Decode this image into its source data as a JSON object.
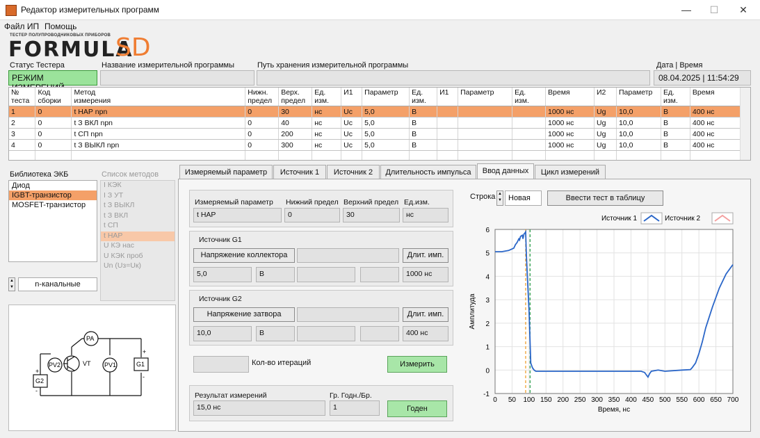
{
  "window": {
    "title": "Редактор измерительных программ",
    "minimize": "—",
    "maximize": "☐",
    "close": "✕"
  },
  "menu": [
    "Файл ИП",
    "Помощь"
  ],
  "logo": {
    "small_text": "ТЕСТЕР ПОЛУПРОВОДНИКОВЫХ ПРИБОРОВ",
    "main": "FORMULA",
    "accent": "SD",
    "accent_color": "#ef7d32"
  },
  "header": {
    "status_label": "Статус Тестера",
    "status_value": "РЕЖИМ ИЗМЕРЕНИЙ",
    "program_name_label": "Название измерительной программы",
    "program_name_value": "",
    "path_label": "Путь хранения измерительной программы",
    "path_value": "",
    "datetime_label": "Дата | Время",
    "datetime_value": "08.04.2025 | 11:54:29"
  },
  "table": {
    "headers": [
      [
        "№",
        "теста"
      ],
      [
        "Код",
        "сборки"
      ],
      [
        "Метод",
        "измерения"
      ],
      [
        "Нижн.",
        "предел"
      ],
      [
        "Верх.",
        "предел"
      ],
      [
        "Ед.",
        "изм."
      ],
      [
        "И1",
        ""
      ],
      [
        "Параметр",
        ""
      ],
      [
        "Ед.",
        "изм."
      ],
      [
        "И1",
        ""
      ],
      [
        "Параметр",
        ""
      ],
      [
        "Ед.",
        "изм."
      ],
      [
        "Время",
        ""
      ],
      [
        "И2",
        ""
      ],
      [
        "Параметр",
        ""
      ],
      [
        "Ед.",
        "изм."
      ],
      [
        "Время",
        ""
      ]
    ],
    "rows": [
      [
        "1",
        "0",
        "t НАР npn",
        "0",
        "30",
        "нс",
        "Uc",
        "5,0",
        "В",
        "",
        "",
        "",
        "1000 нс",
        "Ug",
        "10,0",
        "В",
        "400 нс"
      ],
      [
        "2",
        "0",
        "t З ВКЛ npn",
        "0",
        "40",
        "нс",
        "Uc",
        "5,0",
        "В",
        "",
        "",
        "",
        "1000 нс",
        "Ug",
        "10,0",
        "В",
        "400 нс"
      ],
      [
        "3",
        "0",
        "t СП npn",
        "0",
        "200",
        "нс",
        "Uc",
        "5,0",
        "В",
        "",
        "",
        "",
        "1000 нс",
        "Ug",
        "10,0",
        "В",
        "400 нс"
      ],
      [
        "4",
        "0",
        "t З ВЫКЛ npn",
        "0",
        "300",
        "нс",
        "Uc",
        "5,0",
        "В",
        "",
        "",
        "",
        "1000 нс",
        "Ug",
        "10,0",
        "В",
        "400 нс"
      ]
    ],
    "selected_row": 0
  },
  "library": {
    "label": "Библиотека ЭКБ",
    "items": [
      "Диод",
      "IGBT-транзистор",
      "MOSFET-транзистор"
    ],
    "selected": 1,
    "channel": "n-канальные"
  },
  "methods": {
    "label": "Список методов",
    "items": [
      "I КЭК",
      "I З УТ",
      "t З ВЫКЛ",
      "t З ВКЛ",
      "t СП",
      "t НАР",
      "U КЭ нас",
      "U КЭК проб",
      "Un (Uз=Uк)"
    ],
    "selected": 5
  },
  "schematic": {
    "pa": "PA",
    "pv2": "PV2",
    "vt": "VT",
    "pv1": "PV1",
    "g1": "G1",
    "g2": "G2",
    "plus": "+",
    "minus": "-"
  },
  "tabs": [
    "Измеряемый параметр",
    "Источник 1",
    "Источник 2",
    "Длительность импульса",
    "Ввод данных",
    "Цикл измерений"
  ],
  "active_tab": 4,
  "form": {
    "param_label": "Измеряемый параметр",
    "param_value": "t НАР",
    "low_label": "Нижний предел",
    "low_value": "0",
    "high_label": "Верхний предел",
    "high_value": "30",
    "unit_label": "Ед.изм.",
    "unit_value": "нс",
    "g1_title": "Источник G1",
    "g1_mode": "Напряжение коллектора",
    "g1_value": "5,0",
    "g1_unit": "В",
    "g1_dur_btn": "Длит. имп.",
    "g1_dur": "1000 нс",
    "g2_title": "Источник G2",
    "g2_mode": "Напряжение затвора",
    "g2_value": "10,0",
    "g2_unit": "В",
    "g2_dur_btn": "Длит. имп.",
    "g2_dur": "400 нс",
    "iter_label": "Кол-во итераций",
    "iter_value": "",
    "measure_btn": "Измерить",
    "result_label": "Результат измерений",
    "result_value": "15,0 нс",
    "good_label": "Гр. Годн./Бр.",
    "good_value": "1",
    "good_btn": "Годен",
    "row_label": "Строка",
    "row_value": "Новая",
    "enter_btn": "Ввести тест в таблицу"
  },
  "chart_data": {
    "type": "line",
    "xlabel": "Время, нс",
    "ylabel": "Амплитуда",
    "xlim": [
      0,
      700
    ],
    "ylim": [
      -1,
      6
    ],
    "xticks": [
      0,
      50,
      100,
      150,
      200,
      250,
      300,
      350,
      400,
      450,
      500,
      550,
      600,
      650,
      700
    ],
    "yticks": [
      -1,
      0,
      1,
      2,
      3,
      4,
      5,
      6
    ],
    "grid": true,
    "legend_position": "top-right",
    "series": [
      {
        "name": "Источник 1",
        "color": "#2a66c8",
        "x": [
          0,
          20,
          40,
          55,
          60,
          65,
          70,
          72,
          75,
          80,
          82,
          85,
          88,
          90,
          92,
          95,
          100,
          105,
          110,
          115,
          120,
          150,
          200,
          250,
          300,
          350,
          400,
          430,
          440,
          445,
          450,
          455,
          460,
          480,
          500,
          550,
          575,
          580,
          590,
          600,
          610,
          620,
          640,
          660,
          680,
          700
        ],
        "y": [
          5.05,
          5.05,
          5.1,
          5.2,
          5.35,
          5.45,
          5.6,
          5.55,
          5.7,
          5.75,
          5.6,
          5.8,
          5.85,
          5.9,
          5.0,
          4.0,
          2.5,
          0.3,
          0.1,
          0.0,
          -0.05,
          -0.05,
          -0.05,
          -0.05,
          -0.05,
          -0.05,
          -0.05,
          -0.05,
          -0.1,
          -0.2,
          -0.3,
          -0.15,
          -0.05,
          0.0,
          -0.05,
          0.0,
          0.02,
          0.1,
          0.3,
          0.7,
          1.2,
          1.8,
          2.7,
          3.5,
          4.1,
          4.5
        ]
      },
      {
        "name": "Источник 2",
        "color": "#f4a0a0",
        "x": [],
        "y": []
      }
    ],
    "markers": [
      {
        "x": 90,
        "color": "#f0a030"
      },
      {
        "x": 103,
        "color": "#30a050"
      }
    ]
  }
}
